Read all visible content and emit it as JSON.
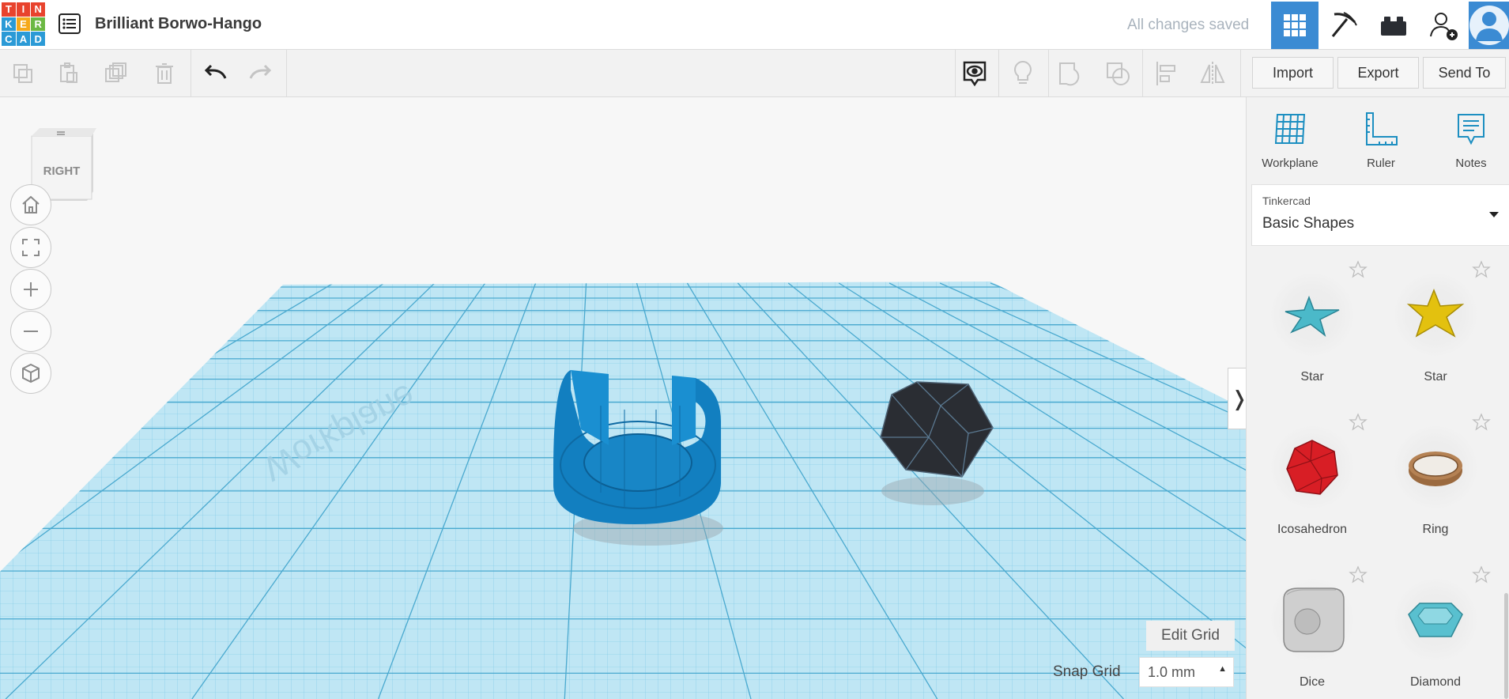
{
  "app": {
    "logo_letters": [
      "T",
      "I",
      "N",
      "K",
      "E",
      "R",
      "C",
      "A",
      "D"
    ],
    "logo_colors": [
      "#e8432d",
      "#e8432d",
      "#e8432d",
      "#2b9ad6",
      "#f5a91b",
      "#6bb843",
      "#2b9ad6",
      "#2b9ad6",
      "#2b9ad6"
    ],
    "design_title": "Brilliant Borwo-Hango",
    "save_status": "All changes saved"
  },
  "header_icons": [
    "grid-view-icon",
    "pickaxe-icon",
    "bricks-icon",
    "add-user-icon",
    "profile-avatar-icon"
  ],
  "toolbar": {
    "import_label": "Import",
    "export_label": "Export",
    "send_to_label": "Send To"
  },
  "viewport": {
    "viewcube_face": "RIGHT",
    "workplane_label": "Workplane",
    "edit_grid_label": "Edit Grid",
    "snap_grid_label": "Snap Grid",
    "snap_grid_value": "1.0 mm"
  },
  "panel": {
    "tools": [
      {
        "label": "Workplane",
        "icon": "workplane-icon"
      },
      {
        "label": "Ruler",
        "icon": "ruler-icon"
      },
      {
        "label": "Notes",
        "icon": "notes-icon"
      }
    ],
    "library": {
      "provider": "Tinkercad",
      "name": "Basic Shapes"
    },
    "shapes": [
      {
        "name": "Star",
        "color": "#4bb9c9"
      },
      {
        "name": "Star",
        "color": "#e3c10f"
      },
      {
        "name": "Icosahedron",
        "color": "#d81e25"
      },
      {
        "name": "Ring",
        "color": "#9b6a3f"
      },
      {
        "name": "Dice",
        "color": "#c9c9c9"
      },
      {
        "name": "Diamond",
        "color": "#59c0cf"
      }
    ]
  },
  "colors": {
    "accent": "#3b8bd3",
    "grid_fill": "#bfe6f4",
    "grid_line": "#5bb6d8",
    "tube_blue": "#127fc0",
    "dark_poly": "#2a2d33"
  }
}
